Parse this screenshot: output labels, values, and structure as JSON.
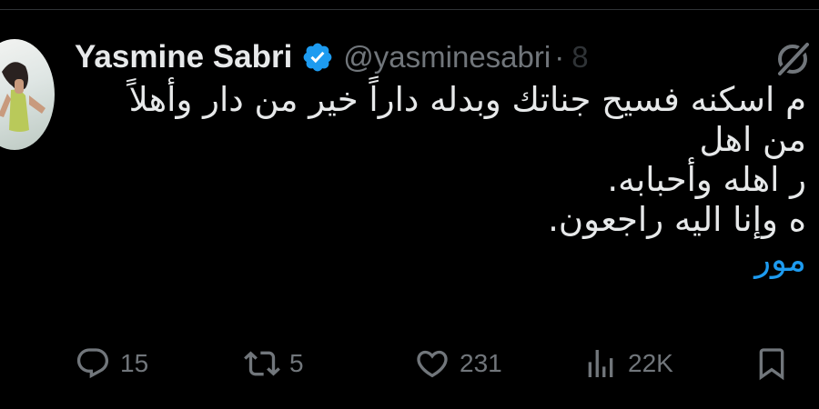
{
  "tweet": {
    "author_name": "Yasmine Sabri",
    "author_handle": "@yasminesabri",
    "separator": "·",
    "time_fragment": "8",
    "lines": [
      "م اسكنه فسيح جناتك وبدله داراً خير من دار وأهلاً",
      "من اهل",
      "ر اهله وأحبابه.",
      "ه وإنا اليه راجعون."
    ],
    "show_more": "مور"
  },
  "actions": {
    "reply_count": "15",
    "retweet_count": "5",
    "like_count": "231",
    "view_count": "22K"
  },
  "colors": {
    "background": "#000000",
    "text": "#e7e9ea",
    "muted": "#71767b",
    "accent": "#1d9bf0"
  },
  "icons": [
    "verified-badge-icon",
    "grok-icon",
    "reply-icon",
    "retweet-icon",
    "like-icon",
    "views-icon",
    "bookmark-icon"
  ]
}
